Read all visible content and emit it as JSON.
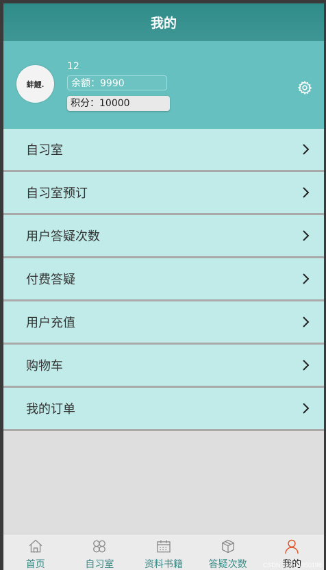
{
  "header": {
    "title": "我的"
  },
  "profile": {
    "avatar_text": "蚌鯉.",
    "username": "12",
    "balance": "余额：9990",
    "points": "积分：10000"
  },
  "menu": [
    {
      "label": "自习室"
    },
    {
      "label": "自习室预订"
    },
    {
      "label": "用户答疑次数"
    },
    {
      "label": "付费答疑"
    },
    {
      "label": "用户充值"
    },
    {
      "label": "购物车"
    },
    {
      "label": "我的订单"
    }
  ],
  "tabbar": [
    {
      "label": "首页",
      "icon": "home-icon"
    },
    {
      "label": "自习室",
      "icon": "grid-icon"
    },
    {
      "label": "资料书籍",
      "icon": "calendar-icon"
    },
    {
      "label": "答疑次数",
      "icon": "box-icon"
    },
    {
      "label": "我的",
      "icon": "user-icon"
    }
  ],
  "watermark": "CSDN @QQ1950198",
  "colors": {
    "header": "#3a918e",
    "profile_bg": "#66c0bf",
    "menu_bg": "#c0ebe9",
    "tab_inactive": "#3a8a86",
    "tab_active_icon": "#e0542b"
  }
}
